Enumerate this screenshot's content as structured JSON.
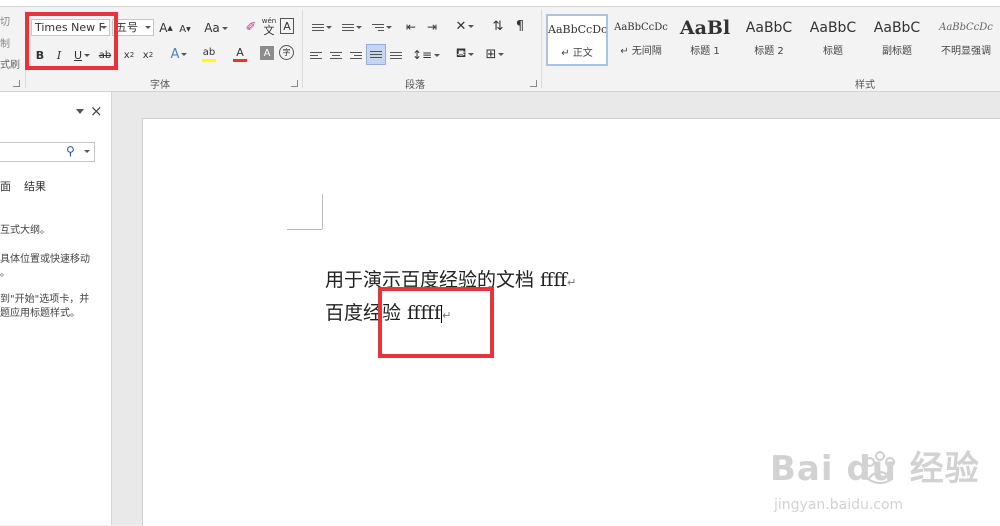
{
  "clipboard": {
    "label_top": "切",
    "label_mid": "制",
    "label_bottom": "式刷"
  },
  "font": {
    "name_value": "Times New F",
    "size_value": "五号",
    "grow": "A",
    "shrink": "A",
    "case": "Aa",
    "phonetic_top": "wén",
    "phonetic_bottom": "文",
    "border_char": "A",
    "bold": "B",
    "italic": "I",
    "underline": "U",
    "strike": "ab",
    "subscript": "x",
    "superscript": "x",
    "effects": "A",
    "highlight": "ab",
    "font_color": "A",
    "shading": "A",
    "enclose": "字",
    "group_label": "字体"
  },
  "paragraph": {
    "group_label": "段落"
  },
  "styles": {
    "group_label": "样式",
    "items": [
      {
        "sample": "AaBbCcDc",
        "name": "↵ 正文"
      },
      {
        "sample": "AaBbCcDc",
        "name": "↵ 无间隔"
      },
      {
        "sample": "AaBl",
        "name": "标题 1"
      },
      {
        "sample": "AaBbC",
        "name": "标题 2"
      },
      {
        "sample": "AaBbC",
        "name": "标题"
      },
      {
        "sample": "AaBbC",
        "name": "副标题"
      },
      {
        "sample": "AaBbCcDc",
        "name": "不明显强调"
      }
    ]
  },
  "nav": {
    "close": "×",
    "tab_pages": "面",
    "tab_results": "结果",
    "line1": "互式大纲。",
    "line2": "具体位置或快速移动",
    "line3": "。",
    "line4": "到\"开始\"选项卡，并",
    "line5": "题应用标题样式。"
  },
  "document": {
    "line1": "用于演示百度经验的文档 ffff",
    "line2": "百度经验 fffff",
    "para_mark": "↵"
  },
  "watermark": {
    "brand": "Bai du 经验",
    "url": "jingyan.baidu.com"
  },
  "colors": {
    "highlight_box": "#e8333b",
    "font_color_bar": "#e8333b",
    "highlight_bar": "#ffff00",
    "selected_style_border": "#a9c2e6"
  }
}
